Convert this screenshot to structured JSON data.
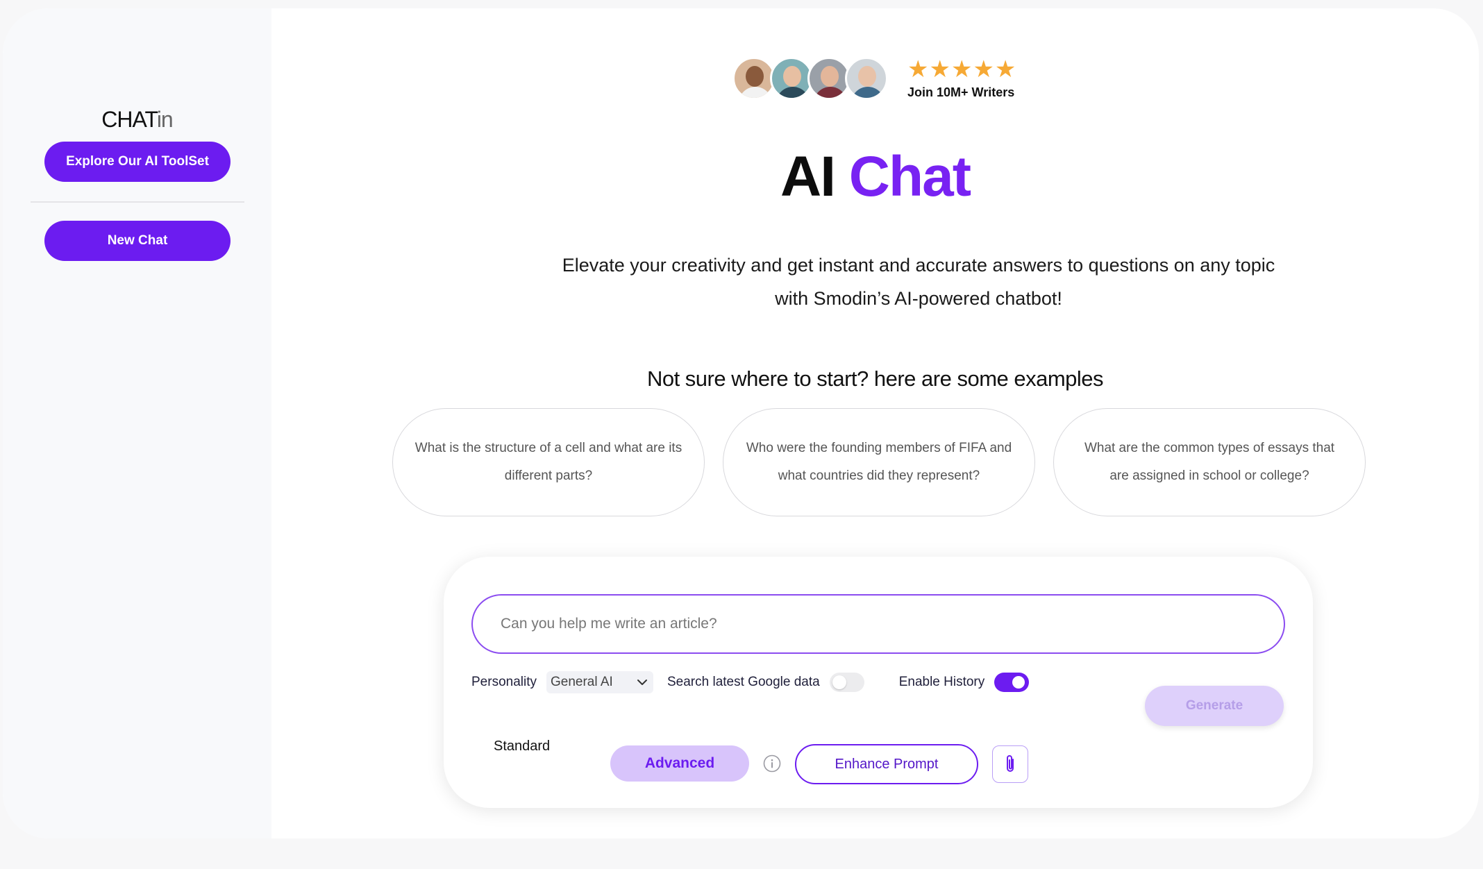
{
  "sidebar": {
    "brand_main": "CHAT",
    "brand_suffix": "in",
    "explore_label": "Explore Our AI ToolSet",
    "new_chat_label": "New Chat"
  },
  "hero": {
    "stars": "★★★★★",
    "rating_value": 5,
    "join_text": "Join 10M+ Writers",
    "title_part1": "AI",
    "title_part2": "Chat",
    "subtitle_line1": "Elevate your creativity and get instant and accurate answers to questions on any topic",
    "subtitle_line2": "with Smodin’s AI-powered chatbot!"
  },
  "examples": {
    "heading": "Not sure where to start? here are some examples",
    "items": [
      {
        "text": "What is the structure of a cell and what are its different parts?"
      },
      {
        "text": "Who were the founding members of FIFA and what countries did they represent?"
      },
      {
        "text": "What are the common types of essays that are assigned in school or college?"
      }
    ]
  },
  "composer": {
    "placeholder": "Can you help me write an article?",
    "personality_label": "Personality",
    "personality_value": "General AI",
    "search_label": "Search latest Google data",
    "search_enabled": false,
    "history_label": "Enable History",
    "history_enabled": true,
    "generate_label": "Generate",
    "mode_standard": "Standard",
    "mode_advanced": "Advanced",
    "enhance_label": "Enhance Prompt"
  },
  "colors": {
    "accent": "#6c1cf0",
    "accent_light": "#d8c4fb",
    "star": "#f6a935"
  },
  "icons": [
    "chevron-down-icon",
    "info-icon",
    "paperclip-icon"
  ]
}
